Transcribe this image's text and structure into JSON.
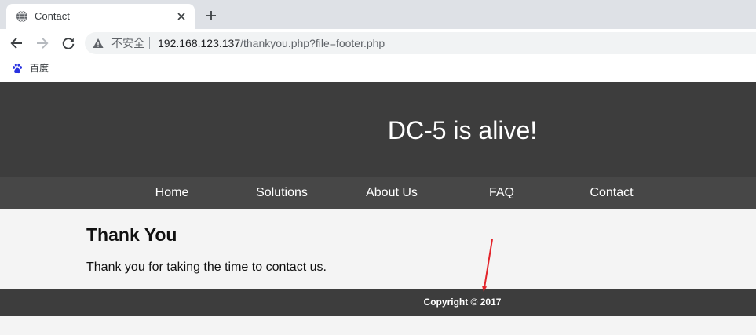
{
  "browser": {
    "tab": {
      "title": "Contact",
      "favicon": "globe-icon",
      "close_icon": "close-icon"
    },
    "new_tab_icon": "plus-icon",
    "toolbar": {
      "back_icon": "back-arrow-icon",
      "forward_icon": "forward-arrow-icon",
      "reload_icon": "reload-icon"
    },
    "address_bar": {
      "security_icon": "warning-triangle-icon",
      "security_label": "不安全",
      "url_host": "192.168.123.137",
      "url_path": "/thankyou.php?file=footer.php"
    },
    "bookmarks": [
      {
        "label": "百度",
        "icon": "baidu-paw-icon"
      }
    ]
  },
  "page": {
    "header": {
      "title": "DC-5 is alive!"
    },
    "nav": {
      "items": [
        {
          "label": "Home"
        },
        {
          "label": "Solutions"
        },
        {
          "label": "About Us"
        },
        {
          "label": "FAQ"
        },
        {
          "label": "Contact"
        }
      ]
    },
    "content": {
      "heading": "Thank You",
      "message": "Thank you for taking the time to contact us."
    },
    "footer": {
      "copyright": "Copyright © 2017"
    }
  },
  "colors": {
    "tabstrip": "#dee1e6",
    "header_bg": "#3d3d3d",
    "header_text": "#ffffff",
    "nav_bg": "#474747",
    "content_bg": "#f4f4f4",
    "footer_bg": "#3d3d3d",
    "annotation": "#e3242b"
  }
}
